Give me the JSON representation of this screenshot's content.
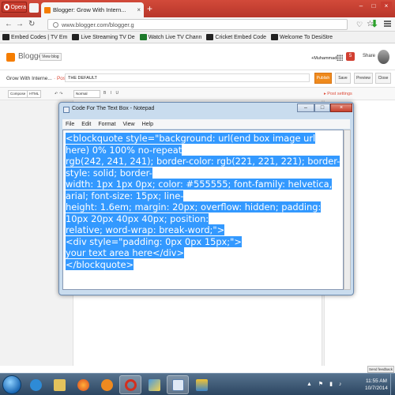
{
  "browser": {
    "menu_label": "Opera",
    "tab_title": "Blogger: Grow With Intern...",
    "tab_close": "×",
    "new_tab": "+",
    "url": "www.blogger.com/blogger.g",
    "window_controls": [
      "–",
      "□",
      "×"
    ]
  },
  "bookmarks": [
    {
      "label": "Embed Codes | TV Em",
      "icon": "bookmark-icon"
    },
    {
      "label": "Live Streaming TV De",
      "icon": "bookmark-icon"
    },
    {
      "label": "Watch Live TV Chann",
      "icon": "tv-icon"
    },
    {
      "label": "Cricket Embed Code",
      "icon": "bookmark-icon"
    },
    {
      "label": "Welcome To DesiStre",
      "icon": "bookmark-icon"
    }
  ],
  "blogger": {
    "logo_text": "Blogger",
    "view_blog": "View blog",
    "user": "+Muhammad",
    "notification_count": "5",
    "share": "Share",
    "blog_name": "Grow With Interne...",
    "post_label": "· Post",
    "post_title": "THE DEFAULT",
    "publish": "Publish",
    "save": "Save",
    "preview": "Preview",
    "close": "Close",
    "compose_tab": "Compose",
    "html_tab": "HTML",
    "font_size": "Normal",
    "post_settings": "▸ Post settings",
    "send_feedback": "Send feedback"
  },
  "notepad": {
    "title": "Code For The Text Box - Notepad",
    "menu": [
      "File",
      "Edit",
      "Format",
      "View",
      "Help"
    ],
    "lines": [
      "<blockquote style=\"background: url(end box image url here) 0% 100% no-repeat",
      "rgb(242, 241, 241); border-color: rgb(221, 221, 221); border-style: solid; border-",
      "width: 1px 1px 0px; color: #555555; font-family: helvetica, arial; font-size: 15px; line-",
      "height: 1.6em; margin: 20px; overflow: hidden; padding: 10px 20px 40px 40px; position:",
      "relative; word-wrap: break-word;\">",
      "<div style=\"padding: 0px 0px 15px;\">",
      "your text area here</div>",
      "</blockquote>"
    ]
  },
  "taskbar": {
    "apps": [
      "explorer",
      "file-manager",
      "firefox",
      "media-player",
      "opera",
      "paint",
      "notepad",
      "paint-program"
    ],
    "time": "11:55 AM",
    "date": "10/7/2014"
  },
  "colors": {
    "selection": "#3399ff",
    "blogger_orange": "#f57d00",
    "publish_orange": "#ef8a1d",
    "opera_red": "#c63a2c"
  }
}
